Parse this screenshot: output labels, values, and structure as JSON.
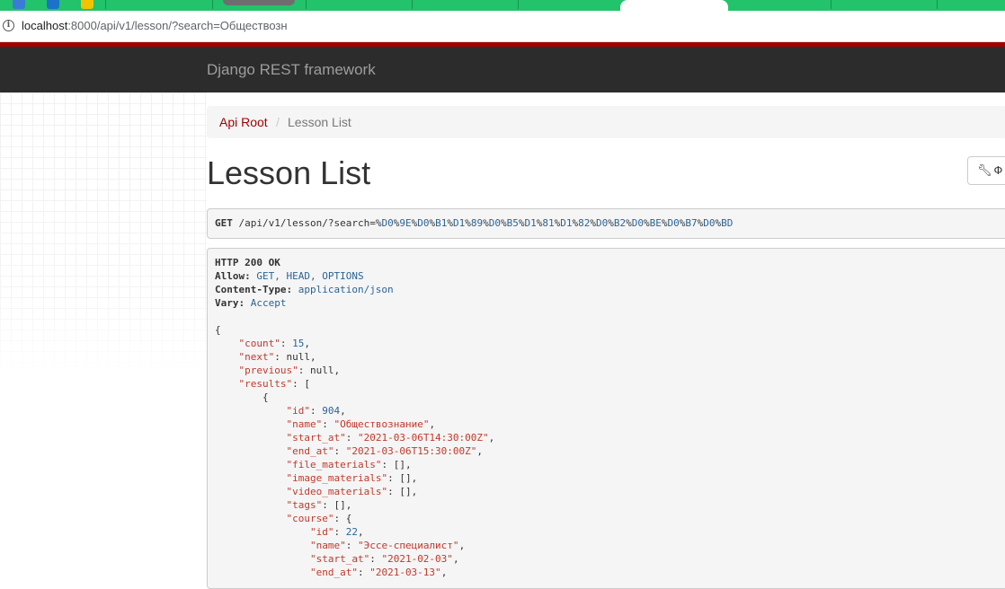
{
  "browser": {
    "url_host": "localhost",
    "url_path": ":8000/api/v1/lesson/?search=Обществозн"
  },
  "navbar": {
    "brand": "Django REST framework"
  },
  "breadcrumb": {
    "root": "Api Root",
    "sep": "/",
    "current": "Lesson List"
  },
  "page": {
    "title": "Lesson List",
    "options_label": "Ф"
  },
  "request": {
    "method": "GET",
    "path": "/api/v1/lesson/?search=",
    "encoded": [
      {
        "pct": "%",
        "hex": "D0"
      },
      {
        "pct": "%",
        "hex": "9E"
      },
      {
        "pct": "%",
        "hex": "D0"
      },
      {
        "pct": "%",
        "hex": "B1"
      },
      {
        "pct": "%",
        "hex": "D1"
      },
      {
        "pct": "%",
        "hex": "89"
      },
      {
        "pct": "%",
        "hex": "D0"
      },
      {
        "pct": "%",
        "hex": "B5"
      },
      {
        "pct": "%",
        "hex": "D1"
      },
      {
        "pct": "%",
        "hex": "81"
      },
      {
        "pct": "%",
        "hex": "D1"
      },
      {
        "pct": "%",
        "hex": "82"
      },
      {
        "pct": "%",
        "hex": "D0"
      },
      {
        "pct": "%",
        "hex": "B2"
      },
      {
        "pct": "%",
        "hex": "D0"
      },
      {
        "pct": "%",
        "hex": "BE"
      },
      {
        "pct": "%",
        "hex": "D0"
      },
      {
        "pct": "%",
        "hex": "B7"
      },
      {
        "pct": "%",
        "hex": "D0"
      },
      {
        "pct": "%",
        "hex": "BD"
      }
    ]
  },
  "response": {
    "status": "HTTP 200 OK",
    "headers": [
      {
        "key": "Allow:",
        "value": "GET, HEAD, OPTIONS"
      },
      {
        "key": "Content-Type:",
        "value": "application/json"
      },
      {
        "key": "Vary:",
        "value": "Accept"
      }
    ],
    "json": {
      "count_key": "\"count\"",
      "count_val": "15",
      "next_key": "\"next\"",
      "next_val": "null",
      "previous_key": "\"previous\"",
      "previous_val": "null",
      "results_key": "\"results\"",
      "item": {
        "id_key": "\"id\"",
        "id_val": "904",
        "name_key": "\"name\"",
        "name_val": "\"Обществознание\"",
        "start_key": "\"start_at\"",
        "start_val": "\"2021-03-06T14:30:00Z\"",
        "end_key": "\"end_at\"",
        "end_val": "\"2021-03-06T15:30:00Z\"",
        "file_key": "\"file_materials\"",
        "file_val": "[]",
        "image_key": "\"image_materials\"",
        "image_val": "[]",
        "video_key": "\"video_materials\"",
        "video_val": "[]",
        "tags_key": "\"tags\"",
        "tags_val": "[]",
        "course_key": "\"course\"",
        "course": {
          "id_key": "\"id\"",
          "id_val": "22",
          "name_key": "\"name\"",
          "name_val": "\"Эссе-специалист\"",
          "start_key": "\"start_at\"",
          "start_val": "\"2021-02-03\"",
          "end_key": "\"end_at\"",
          "end_val": "\"2021-03-13\""
        }
      }
    }
  }
}
